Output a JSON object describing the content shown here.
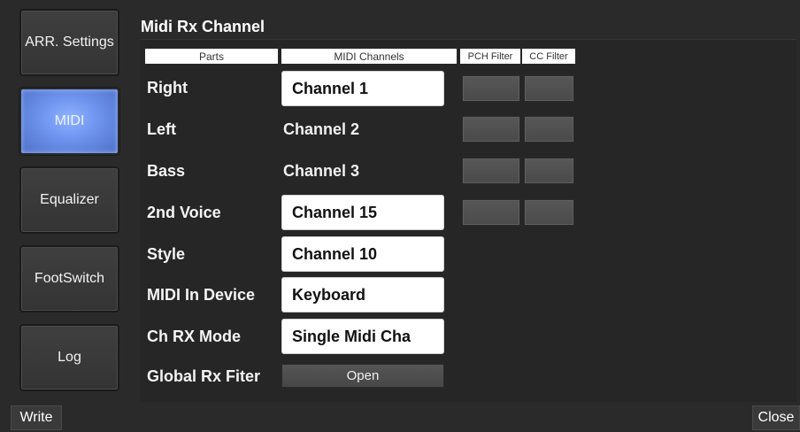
{
  "sidebar": {
    "items": [
      {
        "label": "ARR. Settings",
        "active": false
      },
      {
        "label": "MIDI",
        "active": true
      },
      {
        "label": "Equalizer",
        "active": false
      },
      {
        "label": "FootSwitch",
        "active": false
      },
      {
        "label": "Log",
        "active": false
      }
    ]
  },
  "panel": {
    "title": "Midi Rx Channel",
    "headers": {
      "parts": "Parts",
      "midi_channels": "MIDI Channels",
      "pch_filter": "PCH Filter",
      "cc_filter": "CC Filter"
    },
    "rows": [
      {
        "label": "Right",
        "value": "Channel 1"
      },
      {
        "label": "Left",
        "value": "Channel 2"
      },
      {
        "label": "Bass",
        "value": "Channel 3"
      },
      {
        "label": "2nd Voice",
        "value": "Channel 15"
      },
      {
        "label": "Style",
        "value": "Channel 10"
      },
      {
        "label": "MIDI In Device",
        "value": "Keyboard"
      },
      {
        "label": "Ch RX Mode",
        "value": "Single Midi Cha"
      },
      {
        "label": "Global Rx Fiter",
        "value": "Open"
      }
    ]
  },
  "footer": {
    "write_label": "Write",
    "close_label": "Close"
  },
  "colors": {
    "background": "#2a2a2a",
    "active_tab": "#6f95f0",
    "value_box": "#ffffff",
    "filter_button": "#4f4f4f"
  }
}
